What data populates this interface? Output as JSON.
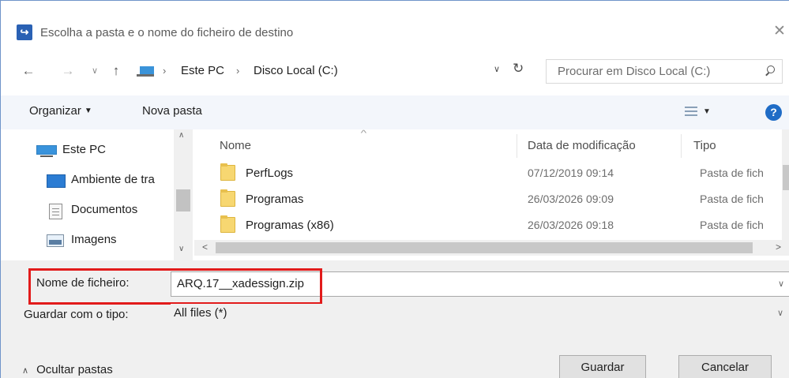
{
  "window": {
    "title": "Escolha a pasta e o nome do ficheiro de destino",
    "app_icon_glyph": "↪",
    "close_glyph": "✕"
  },
  "address": {
    "back_glyph": "←",
    "forward_glyph": "→",
    "recent_glyph": "∨",
    "up_glyph": "↑",
    "separator": "›",
    "crumbs": [
      "Este PC",
      "Disco Local (C:)"
    ],
    "dropdown_glyph": "∨",
    "refresh_glyph": "↻"
  },
  "search": {
    "placeholder": "Procurar em Disco Local (C:)"
  },
  "toolbar": {
    "organize_label": "Organizar",
    "organize_caret": "▼",
    "new_folder_label": "Nova pasta",
    "view_caret": "▼",
    "help_glyph": "?"
  },
  "navpane": {
    "items": [
      {
        "label": "Este PC",
        "icon": "computer-icon"
      },
      {
        "label": "Ambiente de tra",
        "icon": "desktop-icon"
      },
      {
        "label": "Documentos",
        "icon": "documents-icon"
      },
      {
        "label": "Imagens",
        "icon": "pictures-icon"
      }
    ],
    "scroll_up_glyph": "∧",
    "scroll_down_glyph": "∨"
  },
  "filelist": {
    "sort_caret": "^",
    "columns": [
      "Nome",
      "Data de modificação",
      "Tipo"
    ],
    "rows": [
      {
        "name": "PerfLogs",
        "date": "07/12/2019 09:14",
        "type": "Pasta de fich"
      },
      {
        "name": "Programas",
        "date": "26/03/2026 09:09",
        "type": "Pasta de fich"
      },
      {
        "name": "Programas (x86)",
        "date": "26/03/2026 09:18",
        "type": "Pasta de fich"
      }
    ],
    "hscroll_left_glyph": "<",
    "hscroll_right_glyph": ">"
  },
  "form": {
    "filename_label": "Nome de ficheiro:",
    "filename_value": "ARQ.17__xadessign.zip",
    "filetype_label": "Guardar com o tipo:",
    "filetype_value": "All files (*)",
    "dropdown_caret": "∨"
  },
  "footer": {
    "hide_folders_chevron": "∧",
    "hide_folders_label": "Ocultar pastas",
    "save_label": "Guardar",
    "cancel_label": "Cancelar"
  },
  "colors": {
    "highlight": "#e21b1b",
    "accent": "#1f6cc6",
    "commandbar_bg": "#f3f6fb"
  }
}
